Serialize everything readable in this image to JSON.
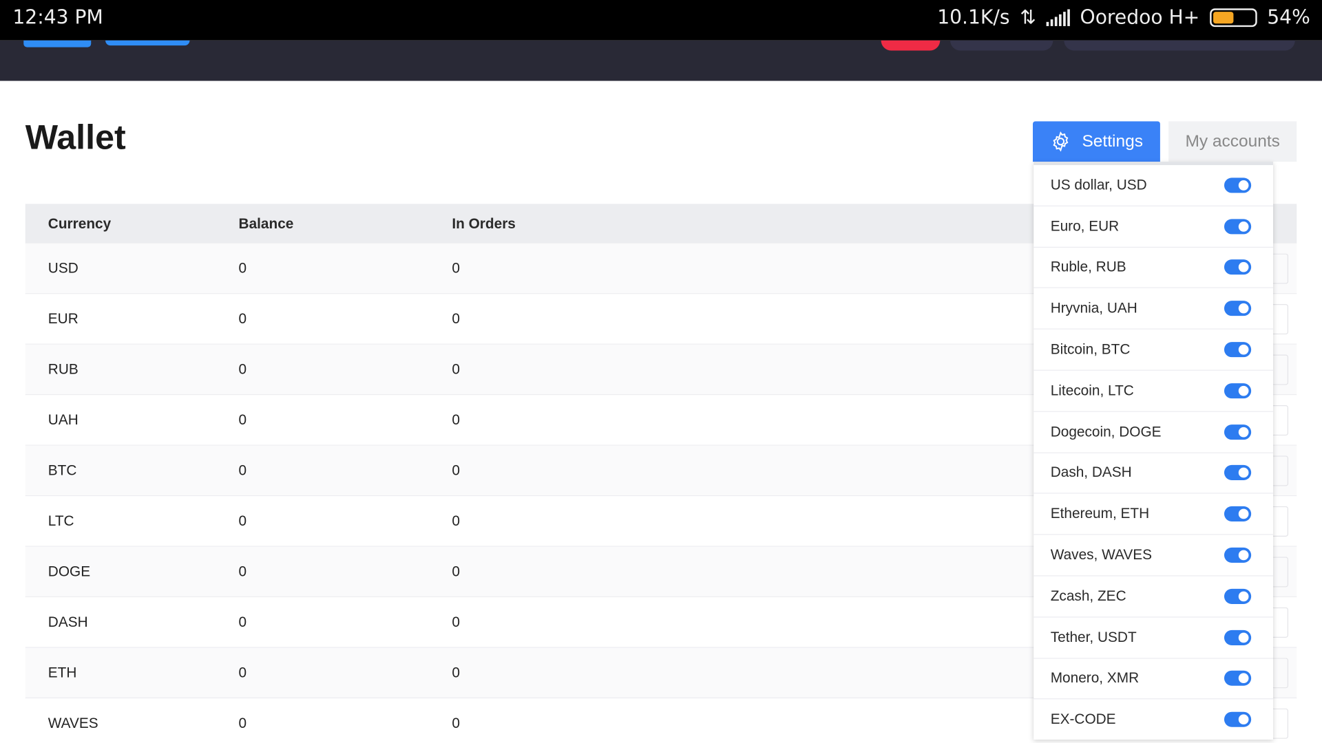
{
  "status_bar": {
    "time": "12:43 PM",
    "speed": "10.1K/s",
    "carrier": "Ooredoo H+",
    "battery": "54%",
    "battery_level": 0.54
  },
  "page": {
    "title": "Wallet",
    "settings_label": "Settings",
    "my_accounts_label": "My accounts"
  },
  "colors": {
    "accent": "#3a82f7",
    "header_bg": "#292936"
  },
  "table": {
    "headers": [
      "Currency",
      "Balance",
      "In Orders"
    ],
    "rows": [
      [
        "USD",
        "0",
        "0"
      ],
      [
        "EUR",
        "0",
        "0"
      ],
      [
        "RUB",
        "0",
        "0"
      ],
      [
        "UAH",
        "0",
        "0"
      ],
      [
        "BTC",
        "0",
        "0"
      ],
      [
        "LTC",
        "0",
        "0"
      ],
      [
        "DOGE",
        "0",
        "0"
      ],
      [
        "DASH",
        "0",
        "0"
      ],
      [
        "ETH",
        "0",
        "0"
      ],
      [
        "WAVES",
        "0",
        "0"
      ]
    ]
  },
  "settings_menu": [
    {
      "label": "US dollar, USD",
      "enabled": true
    },
    {
      "label": "Euro, EUR",
      "enabled": true
    },
    {
      "label": "Ruble, RUB",
      "enabled": true
    },
    {
      "label": "Hryvnia, UAH",
      "enabled": true
    },
    {
      "label": "Bitcoin, BTC",
      "enabled": true
    },
    {
      "label": "Litecoin, LTC",
      "enabled": true
    },
    {
      "label": "Dogecoin, DOGE",
      "enabled": true
    },
    {
      "label": "Dash, DASH",
      "enabled": true
    },
    {
      "label": "Ethereum, ETH",
      "enabled": true
    },
    {
      "label": "Waves, WAVES",
      "enabled": true
    },
    {
      "label": "Zcash, ZEC",
      "enabled": true
    },
    {
      "label": "Tether, USDT",
      "enabled": true
    },
    {
      "label": "Monero, XMR",
      "enabled": true
    },
    {
      "label": "EX-CODE",
      "enabled": true
    }
  ]
}
